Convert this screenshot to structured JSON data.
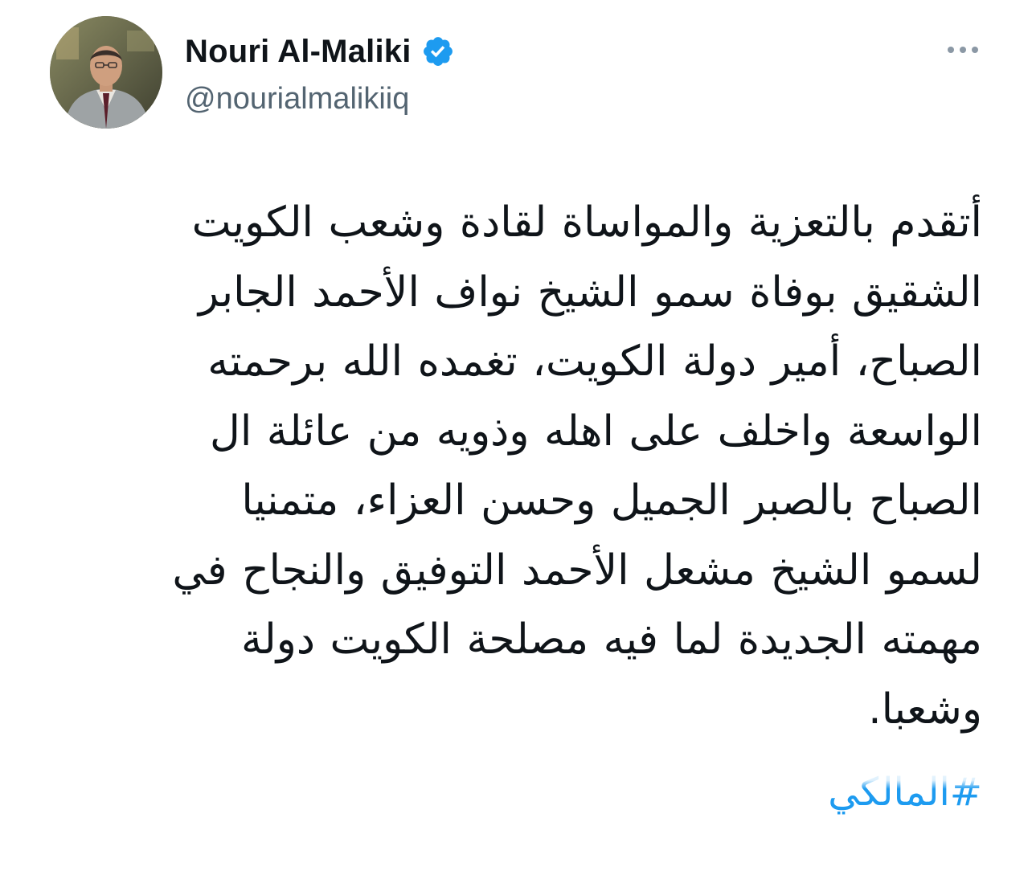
{
  "author": {
    "display_name": "Nouri Al-Maliki",
    "handle": "@nourialmalikiiq",
    "verified": true
  },
  "icons": {
    "verified": "verified-badge-icon",
    "more": "more-horizontal-icon",
    "avatar": "profile-photo"
  },
  "colors": {
    "text": "#0f1419",
    "secondary": "#536471",
    "link": "#1d9bf0",
    "verified": "#1d9bf0"
  },
  "tweet": {
    "lines": [
      "أتقدم بالتعزية والمواساة لقادة وشعب الكويت",
      "الشقيق بوفاة سمو الشيخ نواف الأحمد الجابر",
      "الصباح، أمير دولة الكويت، تغمده الله برحمته",
      "الواسعة واخلف على اهله وذويه من عائلة ال",
      "الصباح بالصبر الجميل وحسن العزاء، متمنيا",
      "لسمو الشيخ مشعل الأحمد التوفيق والنجاح في",
      "مهمته الجديدة لما فيه مصلحة الكويت دولة",
      "وشعبا."
    ],
    "hashtag": "#المالكي"
  }
}
